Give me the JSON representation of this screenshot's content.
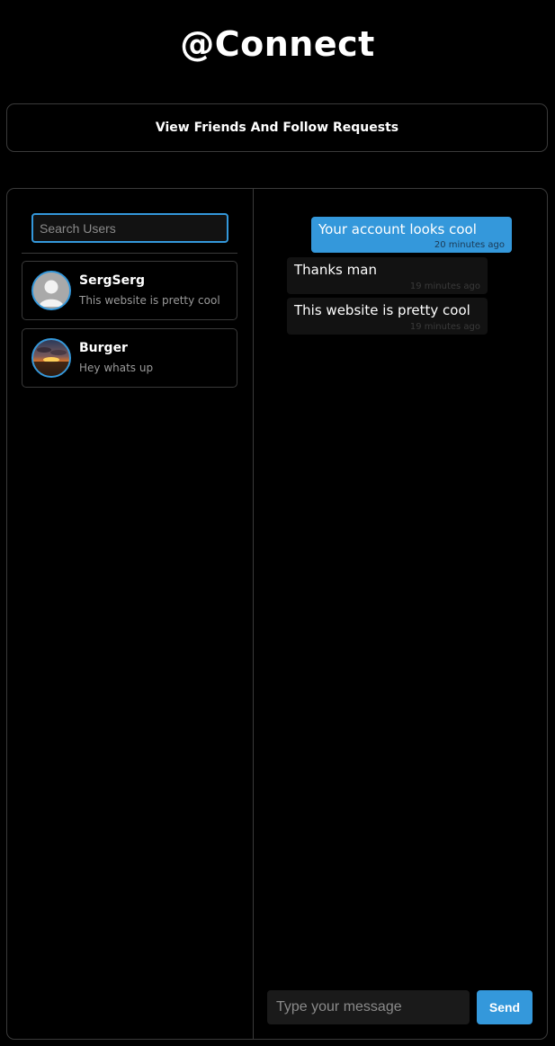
{
  "header": {
    "title": "@Connect"
  },
  "friends_button": {
    "label": "View Friends And Follow Requests"
  },
  "sidebar": {
    "search": {
      "placeholder": "Search Users",
      "value": ""
    },
    "users": [
      {
        "name": "SergSerg",
        "preview": "This website is pretty cool",
        "avatar": "default-avatar-icon"
      },
      {
        "name": "Burger",
        "preview": "Hey whats up",
        "avatar": "sunset-photo"
      }
    ]
  },
  "conversation": {
    "messages": [
      {
        "text": "Your account looks cool",
        "time": "20 minutes ago",
        "direction": "sent"
      },
      {
        "text": "Thanks man",
        "time": "19 minutes ago",
        "direction": "received"
      },
      {
        "text": "This website is pretty cool",
        "time": "19 minutes ago",
        "direction": "received"
      }
    ],
    "composer": {
      "placeholder": "Type your message",
      "value": ""
    },
    "send_label": "Send"
  },
  "colors": {
    "accent": "#3498db",
    "background": "#000000",
    "border": "#3a3a3a",
    "received_bubble": "#121212"
  }
}
